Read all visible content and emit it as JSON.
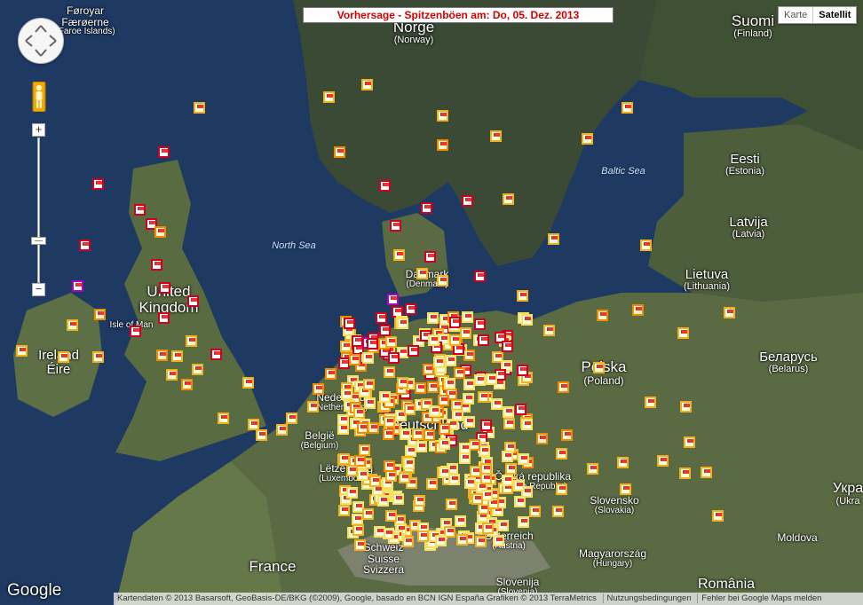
{
  "title": "Vorhersage - Spitzenböen am: Do, 05. Dez. 2013",
  "map_type": {
    "karte": "Karte",
    "satellit": "Satellit",
    "active": "Satellit"
  },
  "zoom": {
    "in": "+",
    "out": "−"
  },
  "footer": {
    "logo": "Google",
    "attribution": "Kartendaten © 2013 Basarsoft, GeoBasis-DE/BKG (©2009), Google, basado en BCN IGN España Grafiken © 2013 TerraMetrics",
    "terms": "Nutzungsbedingungen",
    "report": "Fehler bei Google Maps melden"
  },
  "countries": [
    {
      "name": "Føroyar",
      "sub": "Færøerne",
      "sub2": "(Faroe Islands)"
    },
    {
      "name": "Norge",
      "sub": "(Norway)"
    },
    {
      "name": "Suomi",
      "sub": "(Finland)"
    },
    {
      "name": "Eesti",
      "sub": "(Estonia)"
    },
    {
      "name": "Latvija",
      "sub": "(Latvia)"
    },
    {
      "name": "Lietuva",
      "sub": "(Lithuania)"
    },
    {
      "name": "Danmark",
      "sub": "(Denmark)"
    },
    {
      "name": "United",
      "sub": "Kingdom"
    },
    {
      "name": "Isle of Man",
      "sub": ""
    },
    {
      "name": "Ireland",
      "sub": "Éire"
    },
    {
      "name": "Nederland",
      "sub": "(Netherlands)"
    },
    {
      "name": "België",
      "sub": "(Belgium)"
    },
    {
      "name": "Lëtzebuerg",
      "sub": "(Luxembourg)"
    },
    {
      "name": "Deutschland",
      "sub": ""
    },
    {
      "name": "Polska",
      "sub": "(Poland)"
    },
    {
      "name": "Беларусь",
      "sub": "(Belarus)"
    },
    {
      "name": "Česká republika",
      "sub": "(Czech Republic)"
    },
    {
      "name": "Slovensko",
      "sub": "(Slovakia)"
    },
    {
      "name": "Укра",
      "sub": "(Ukra"
    },
    {
      "name": "Magyarország",
      "sub": "(Hungary)"
    },
    {
      "name": "Schweiz",
      "sub": "Suisse",
      "sub2": "Svizzera"
    },
    {
      "name": "France",
      "sub": ""
    },
    {
      "name": "Österreich",
      "sub": "(Austria)"
    },
    {
      "name": "Slovenija",
      "sub": "(Slovenia)"
    },
    {
      "name": "Moldova",
      "sub": ""
    },
    {
      "name": "România",
      "sub": ""
    }
  ],
  "seas": [
    "North Sea",
    "Baltic Sea"
  ],
  "colors": {
    "title_text": "#d10000",
    "marker_red": "#d2001e",
    "marker_orange": "#f08a00",
    "marker_yellow": "#f2b01e",
    "marker_lightyellow": "#f7e15a",
    "marker_purple": "#b000c8"
  },
  "icons": [
    "pan-control-icon",
    "pegman-icon",
    "station-flag-icon"
  ]
}
